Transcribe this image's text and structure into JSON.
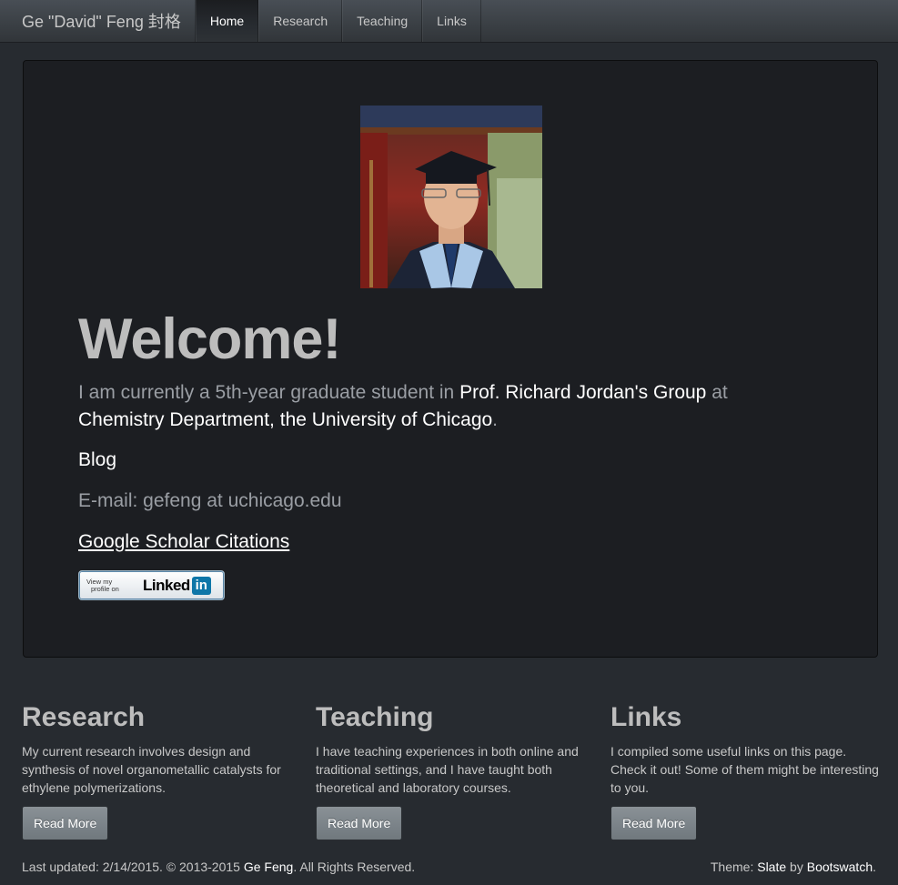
{
  "navbar": {
    "brand": "Ge \"David\" Feng 封格",
    "items": [
      {
        "label": "Home",
        "active": true
      },
      {
        "label": "Research"
      },
      {
        "label": "Teaching"
      },
      {
        "label": "Links"
      }
    ]
  },
  "jumbotron": {
    "heading": "Welcome!",
    "lead_prefix": "I am currently a 5th-year graduate student in ",
    "lead_group": "Prof. Richard Jordan's Group",
    "lead_mid": " at ",
    "lead_department": "Chemistry Department, the University of Chicago",
    "lead_suffix": ".",
    "blog": "Blog",
    "email": "E-mail: gefeng at uchicago.edu",
    "scholar": "Google Scholar Citations",
    "linkedin": {
      "line1": "View my",
      "line2": "profile on",
      "brand": "Linked",
      "in": "in"
    }
  },
  "columns": [
    {
      "title": "Research",
      "text": "My current research involves design and synthesis of novel organometallic catalysts for ethylene polymerizations.",
      "button": "Read More"
    },
    {
      "title": "Teaching",
      "text": "I have teaching experiences in both online and traditional settings, and I have taught both theoretical and laboratory courses.",
      "button": "Read More"
    },
    {
      "title": "Links",
      "text": "I compiled some useful links on this page. Check it out! Some of them might be interesting to you.",
      "button": "Read More"
    }
  ],
  "footer": {
    "left_prefix": "Last updated: 2/14/2015. © 2013-2015 ",
    "left_name": "Ge Feng",
    "left_suffix": ". All Rights Reserved.",
    "right_prefix": "Theme: ",
    "right_theme": "Slate",
    "right_mid": " by ",
    "right_by": "Bootswatch",
    "right_suffix": "."
  }
}
